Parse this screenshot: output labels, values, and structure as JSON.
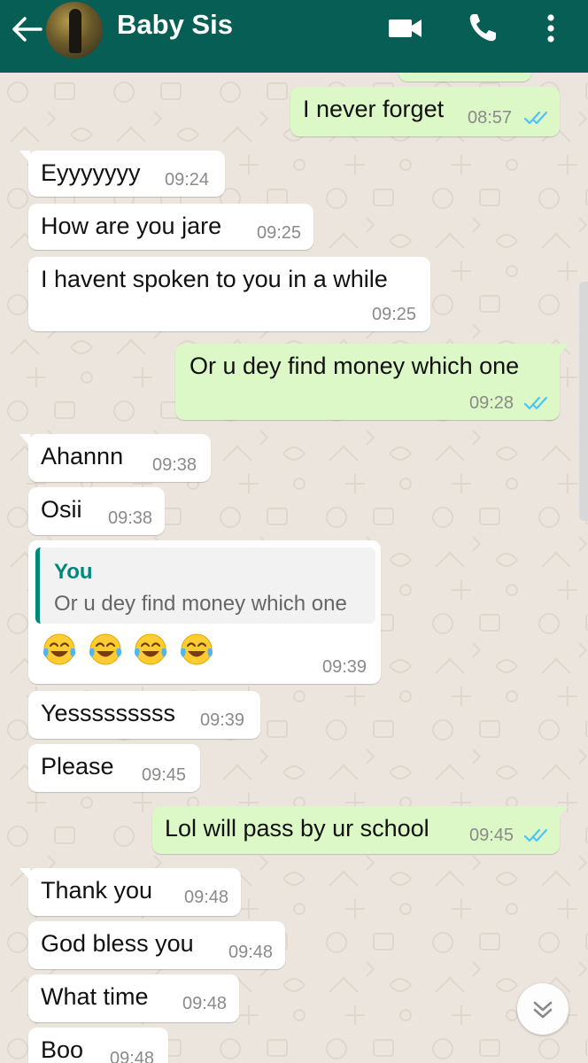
{
  "header": {
    "contact_name": "Baby Sis",
    "icons": [
      "back-arrow-icon",
      "video-call-icon",
      "phone-call-icon",
      "more-options-icon"
    ]
  },
  "colors": {
    "header": "#075e54",
    "incoming_bubble": "#ffffff",
    "outgoing_bubble": "#dcf8c6",
    "wallpaper": "#ece5dd",
    "read_ticks": "#4fc3f7",
    "quote_accent": "#00897b"
  },
  "messages": [
    {
      "direction": "out",
      "text": "I never forget",
      "time": "08:57",
      "status": "read"
    },
    {
      "direction": "in",
      "text": "Eyyyyyyy",
      "time": "09:24"
    },
    {
      "direction": "in",
      "text": "How are you jare",
      "time": "09:25"
    },
    {
      "direction": "in",
      "text": "I havent spoken to you in a while",
      "time": "09:25"
    },
    {
      "direction": "out",
      "text": "Or u dey find money which one",
      "time": "09:28",
      "status": "read"
    },
    {
      "direction": "in",
      "text": "Ahannn",
      "time": "09:38"
    },
    {
      "direction": "in",
      "text": "Osii",
      "time": "09:38"
    },
    {
      "direction": "in",
      "quote_author": "You",
      "quote_text": "Or u dey find money which one",
      "text": "😂😂😂😂",
      "time": "09:39"
    },
    {
      "direction": "in",
      "text": "Yesssssssss",
      "time": "09:39"
    },
    {
      "direction": "in",
      "text": "Please",
      "time": "09:45"
    },
    {
      "direction": "out",
      "text": "Lol will pass by ur school",
      "time": "09:45",
      "status": "read"
    },
    {
      "direction": "in",
      "text": "Thank you",
      "time": "09:48"
    },
    {
      "direction": "in",
      "text": "God bless you",
      "time": "09:48"
    },
    {
      "direction": "in",
      "text": "What time",
      "time": "09:48"
    },
    {
      "direction": "in",
      "text": "Boo",
      "time": "09:48"
    }
  ]
}
